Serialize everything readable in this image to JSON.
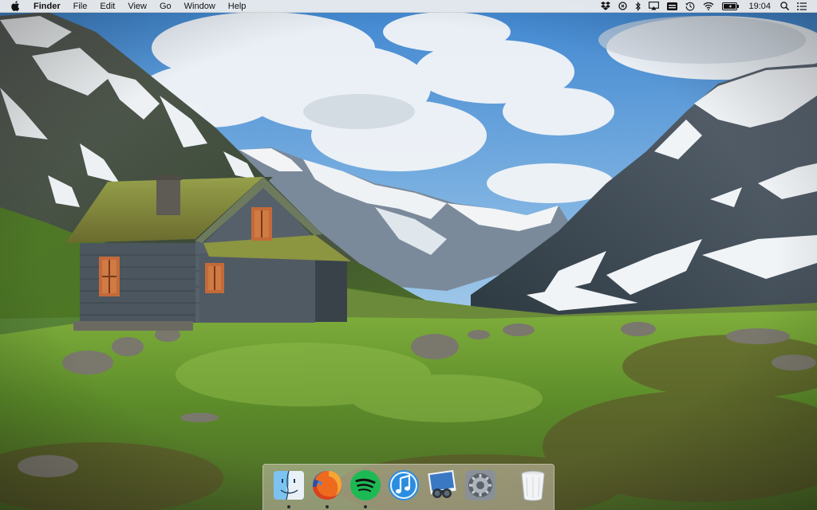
{
  "menubar": {
    "apple_icon": "apple-logo-icon",
    "app_name": "Finder",
    "menus": [
      "File",
      "Edit",
      "View",
      "Go",
      "Window",
      "Help"
    ],
    "status_icons": [
      "dropbox-icon",
      "sync-icon",
      "bluetooth-icon",
      "airplay-icon",
      "keyboard-input-icon",
      "time-machine-icon",
      "wifi-icon",
      "battery-icon"
    ],
    "clock": "19:04",
    "spotlight_icon": "search-icon",
    "notification_icon": "notification-center-icon"
  },
  "dock": {
    "apps": [
      {
        "name": "Finder",
        "icon": "finder-icon",
        "running": true
      },
      {
        "name": "Firefox",
        "icon": "firefox-icon",
        "running": true
      },
      {
        "name": "Spotify",
        "icon": "spotify-icon",
        "running": true
      },
      {
        "name": "iTunes",
        "icon": "itunes-icon",
        "running": false
      },
      {
        "name": "Preview",
        "icon": "preview-icon",
        "running": false
      },
      {
        "name": "System Preferences",
        "icon": "system-preferences-icon",
        "running": false
      }
    ],
    "trash": {
      "name": "Trash",
      "icon": "trash-icon"
    }
  },
  "colors": {
    "menubar_bg": "#f0f0f0",
    "sky": "#4a8fd4",
    "grass": "#5a8f2a",
    "snow": "#f4f6f8",
    "cabin_roof": "#7c8a3a",
    "cabin_wall": "#4a5560"
  }
}
